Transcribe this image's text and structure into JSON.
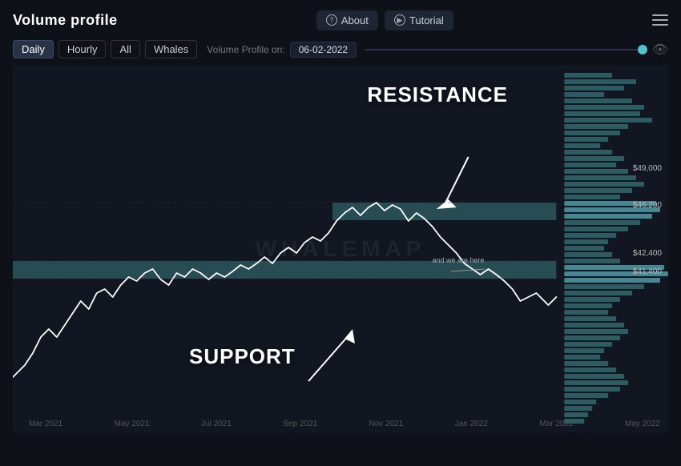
{
  "app": {
    "title": "Volume profile"
  },
  "header": {
    "about_label": "About",
    "tutorial_label": "Tutorial",
    "about_icon": "?",
    "tutorial_icon": "▶"
  },
  "toolbar": {
    "tabs": [
      {
        "label": "Daily",
        "active": true
      },
      {
        "label": "Hourly",
        "active": false
      },
      {
        "label": "All",
        "active": false
      },
      {
        "label": "Whales",
        "active": false
      }
    ],
    "volume_profile_label": "Volume Profile on:",
    "date": "06-02-2022"
  },
  "chart": {
    "watermark": "WHALEMAP",
    "resistance_label": "RESISTANCE",
    "support_label": "SUPPORT",
    "we_are_here": "and we are here",
    "price_levels": [
      {
        "price": "$49,000",
        "top_pct": 28
      },
      {
        "price": "$46,200",
        "top_pct": 38
      },
      {
        "price": "$42,400",
        "top_pct": 50
      },
      {
        "price": "$41,400",
        "top_pct": 55
      }
    ],
    "x_labels": [
      "Mar 2021",
      "May 2021",
      "Jul 2021",
      "Sep 2021",
      "Nov 2021",
      "Jan 2022",
      "Mar 2022",
      "May 2022"
    ]
  }
}
